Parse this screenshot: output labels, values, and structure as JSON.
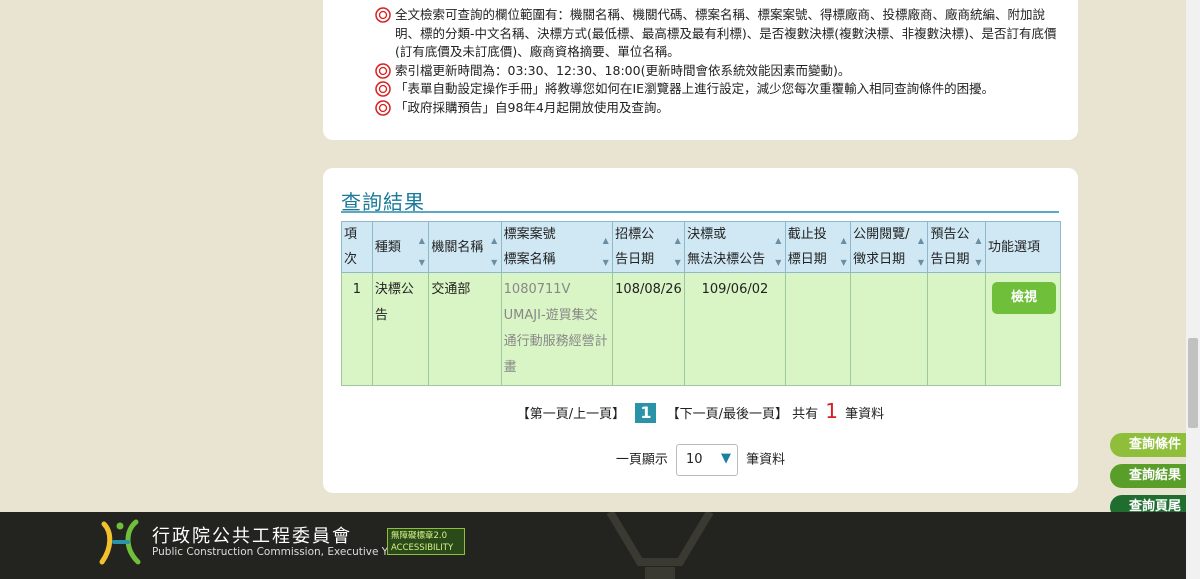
{
  "notes": [
    "全文檢索可查詢的欄位範圍有：機關名稱、機關代碼、標案名稱、標案案號、得標廠商、投標廠商、廠商統編、附加說明、標的分類-中文名稱、決標方式(最低標、最高標及最有利標)、是否複數決標(複數決標、非複數決標)、是否訂有底價(訂有底價及未訂底價)、廠商資格摘要、單位名稱。",
    "索引檔更新時間為：03:30、12:30、18:00(更新時間會依系統效能因素而變動)。",
    "「表單自動設定操作手冊」將教導您如何在IE瀏覽器上進行設定，減少您每次重覆輸入相同查詢條件的困擾。",
    "「政府採購預告」自98年4月起開放使用及查詢。"
  ],
  "results": {
    "title": "查詢結果",
    "headers": {
      "no": "項次",
      "type": "種類",
      "agency": "機關名稱",
      "case_no_1": "標案案號",
      "case_no_2": "標案名稱",
      "tender_1": "招標公",
      "tender_2": "告日期",
      "award_1": "決標或",
      "award_2": "無法決標公告",
      "deadline_1": "截止投",
      "deadline_2": "標日期",
      "public_1": "公開閱覽/",
      "public_2": "徵求日期",
      "notice_1": "預告公",
      "notice_2": "告日期",
      "action": "功能選項"
    },
    "rows": [
      {
        "no": "1",
        "type": "決標公告",
        "agency": "交通部",
        "case_no": "1080711V",
        "case_name": "UMAJI-遊買集交通行動服務經營計畫",
        "tender_date": "108/08/26",
        "award_date": "109/06/02",
        "deadline": "",
        "public_date": "",
        "notice_date": "",
        "action": "檢視"
      }
    ]
  },
  "pager": {
    "first_prev": "【第一頁/上一頁】",
    "current": "1",
    "next_last": "【下一頁/最後一頁】",
    "total_prefix": "共有",
    "total": "1",
    "total_suffix": "筆資料",
    "per_page_label": "一頁顯示",
    "per_page_value": "10",
    "per_page_suffix": "筆資料"
  },
  "side_tabs": {
    "query": "查詢條件",
    "result": "查詢結果",
    "bottom": "查詢頁尾"
  },
  "footer": {
    "name": "行政院公共工程委員會",
    "en": "Public Construction Commission, Executive Yuan",
    "badge": "無障礙標章2.0 ACCESSIBILITY"
  },
  "colors": {
    "accent": "#1a7a99",
    "header_bg": "#cfe8f4",
    "row_bg": "#d9f5c5",
    "view_button": "#6fbf3a",
    "bullet": "#d92020"
  }
}
